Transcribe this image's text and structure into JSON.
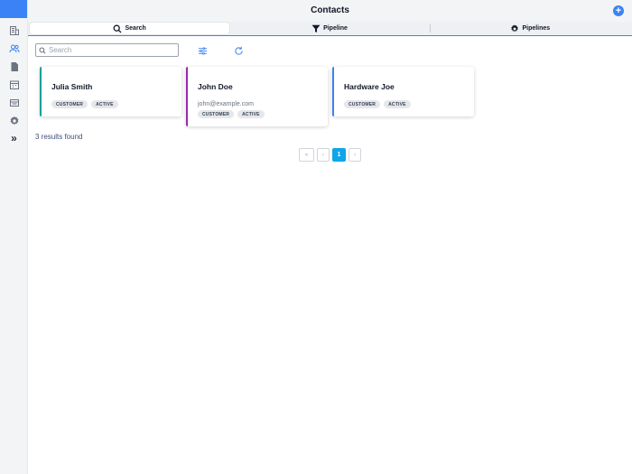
{
  "header": {
    "title": "Contacts",
    "add_label": "+"
  },
  "sidebar": {
    "items": [
      {
        "name": "companies",
        "icon": "building-icon"
      },
      {
        "name": "contacts",
        "icon": "users-icon",
        "active": true
      },
      {
        "name": "documents",
        "icon": "document-icon"
      },
      {
        "name": "calendar",
        "icon": "calendar-icon"
      },
      {
        "name": "inbox",
        "icon": "inbox-icon"
      },
      {
        "name": "settings",
        "icon": "gear-icon"
      }
    ],
    "expand_label": "»"
  },
  "tabs": [
    {
      "label": "Search",
      "icon": "search-icon",
      "active": true
    },
    {
      "label": "Pipeline",
      "icon": "filter-icon",
      "active": false
    },
    {
      "label": "Pipelines",
      "icon": "gear-icon",
      "active": false
    }
  ],
  "search": {
    "placeholder": "Search",
    "value": ""
  },
  "cards": [
    {
      "name": "Julia Smith",
      "email": "",
      "badges": [
        "CUSTOMER",
        "ACTIVE"
      ],
      "accent": "#14a098"
    },
    {
      "name": "John Doe",
      "email": "john@example.com",
      "badges": [
        "CUSTOMER",
        "ACTIVE"
      ],
      "accent": "#9c27b0"
    },
    {
      "name": "Hardware Joe",
      "email": "",
      "badges": [
        "CUSTOMER",
        "ACTIVE"
      ],
      "accent": "#3b82f6"
    }
  ],
  "results_text": "3 results found",
  "pagination": {
    "first": "«",
    "prev": "‹",
    "current": "1",
    "next": "›"
  },
  "colors": {
    "primary": "#3b82f6",
    "page_active": "#0ea5e9"
  }
}
